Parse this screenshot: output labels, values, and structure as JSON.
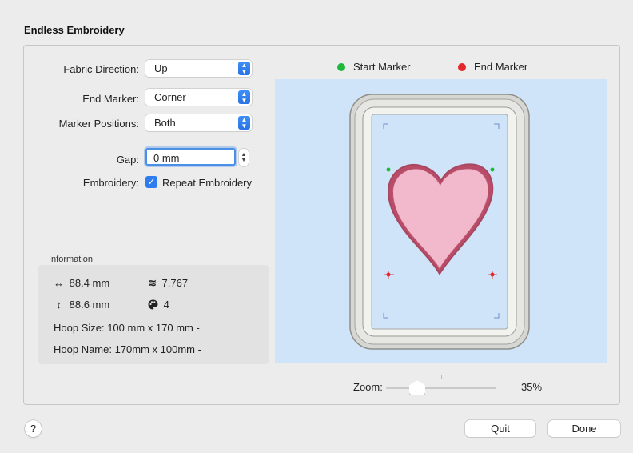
{
  "window": {
    "title": "Endless Embroidery"
  },
  "form": {
    "fabric_direction": {
      "label": "Fabric Direction:",
      "value": "Up"
    },
    "end_marker": {
      "label": "End Marker:",
      "value": "Corner"
    },
    "marker_positions": {
      "label": "Marker Positions:",
      "value": "Both"
    },
    "gap": {
      "label": "Gap:",
      "value": "0 mm"
    },
    "embroidery": {
      "label": "Embroidery:",
      "checkbox_label": "Repeat Embroidery",
      "checked": true
    }
  },
  "information": {
    "title": "Information",
    "width": "88.4 mm",
    "height": "88.6 mm",
    "stitches": "7,767",
    "colors": "4",
    "hoop_size": "Hoop Size: 100 mm x 170 mm -",
    "hoop_name": "Hoop Name: 170mm x 100mm -"
  },
  "legend": {
    "start_marker": {
      "label": "Start Marker",
      "color": "#1eb83a"
    },
    "end_marker": {
      "label": "End Marker",
      "color": "#e5262b"
    }
  },
  "zoom": {
    "label": "Zoom:",
    "value": "35%",
    "level": 0.35
  },
  "buttons": {
    "quit": "Quit",
    "done": "Done",
    "help": "?"
  },
  "icons": {
    "width": "horizontal-arrows-icon",
    "height": "vertical-arrows-icon",
    "stitches": "stitch-count-icon",
    "colors": "palette-icon"
  }
}
